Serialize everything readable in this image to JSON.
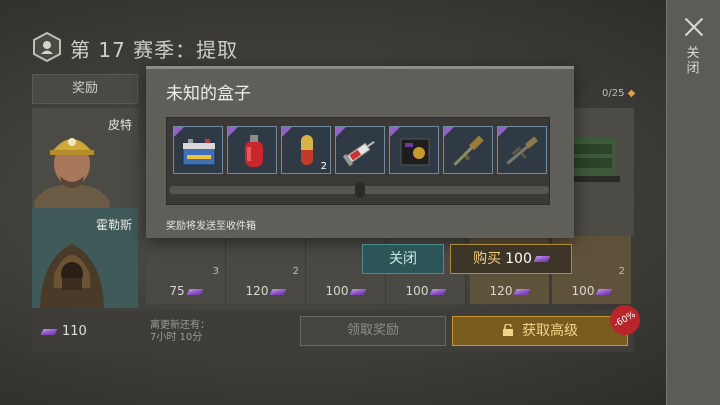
{
  "header": {
    "title": "第 17 赛季：提取"
  },
  "tabs": {
    "rewards": "奖励"
  },
  "progress": {
    "label": "0/25"
  },
  "side": {
    "close_label": "关闭"
  },
  "characters": [
    {
      "name": "皮特"
    },
    {
      "name": "霍勒斯"
    }
  ],
  "reward_columns": [
    {
      "count": "3",
      "price": "75"
    },
    {
      "count": "2",
      "price": "120"
    },
    {
      "count": "",
      "price": "100"
    },
    {
      "count": "",
      "price": "100"
    },
    {
      "count": "",
      "price": "120"
    },
    {
      "count": "2",
      "price": "100"
    }
  ],
  "bottom": {
    "balance": "110",
    "refresh_line1": "离更新还有：",
    "refresh_line2": "7小时 10分",
    "claim_label": "领取奖励",
    "premium_label": "获取高级",
    "discount": "-60%"
  },
  "modal": {
    "title": "未知的盒子",
    "note": "奖励将发送至收件箱",
    "items": [
      {
        "icon": "battery-icon",
        "qty": ""
      },
      {
        "icon": "gas-canister-icon",
        "qty": ""
      },
      {
        "icon": "pill-capsule-icon",
        "qty": "2"
      },
      {
        "icon": "syringe-icon",
        "qty": ""
      },
      {
        "icon": "badge-wallet-icon",
        "qty": ""
      },
      {
        "icon": "shotgun-icon",
        "qty": ""
      },
      {
        "icon": "rifle-icon",
        "qty": ""
      }
    ],
    "close_label": "关闭",
    "buy_label": "购买",
    "buy_price": "100"
  },
  "colors": {
    "accent_gold": "#c9972e",
    "accent_teal": "#4c8a8b",
    "gem_purple": "#8a4ec3",
    "rarity_purple": "#8f63c7"
  }
}
